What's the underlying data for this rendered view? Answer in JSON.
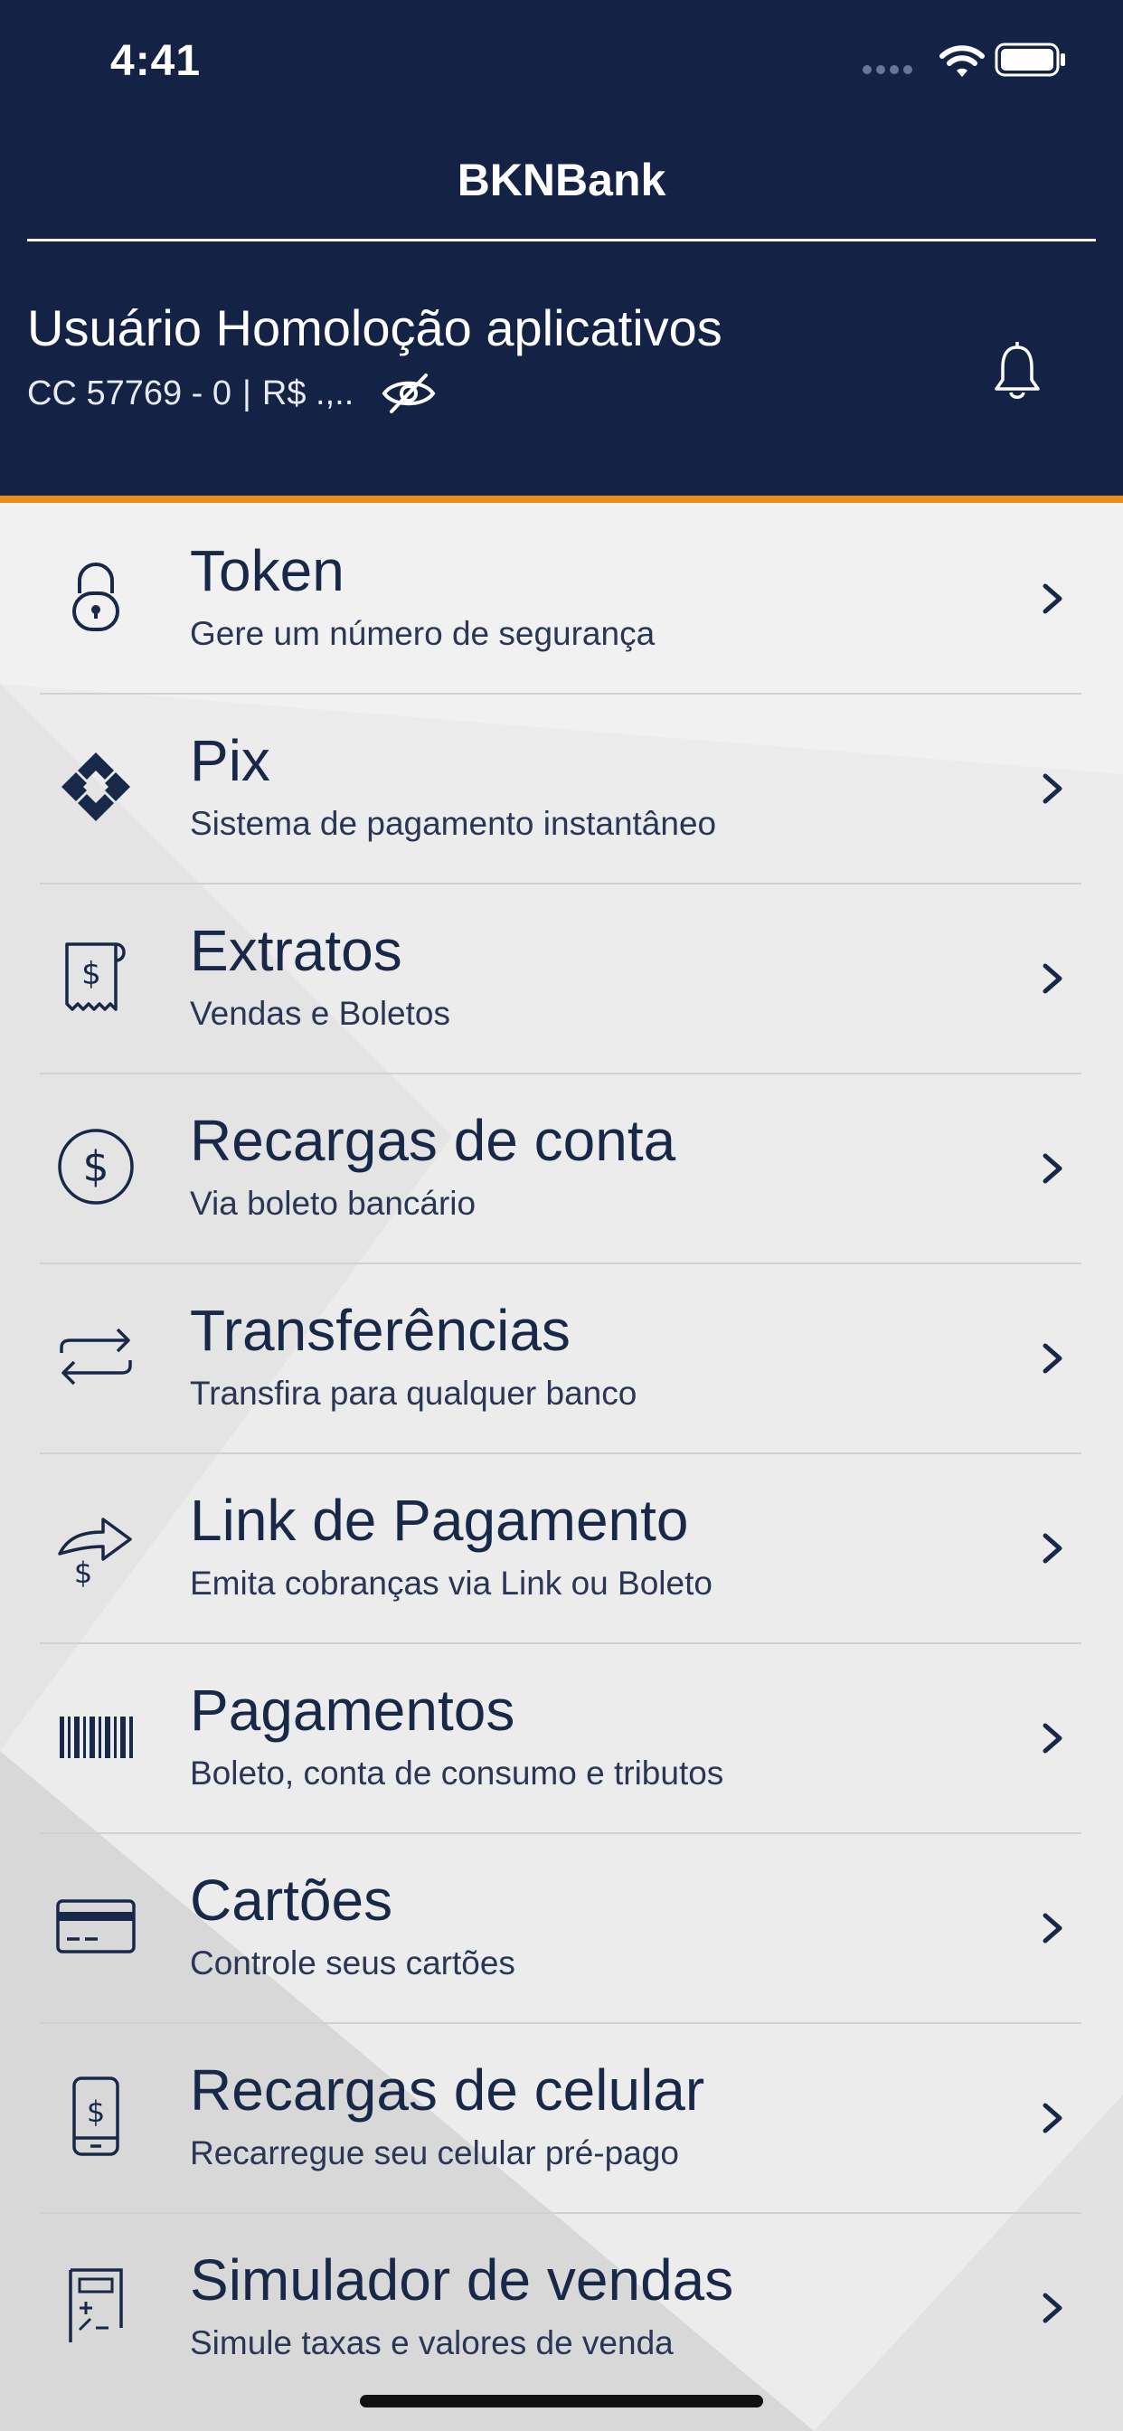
{
  "status_bar": {
    "time": "4:41"
  },
  "header": {
    "app_title": "BKNBank",
    "user_name": "Usuário Homoloção aplicativos",
    "account": "CC 57769 - 0",
    "separator": "|",
    "balance": "R$ .,..",
    "eye_icon": "eye-slash-icon",
    "bell_icon": "bell-icon"
  },
  "colors": {
    "header_bg": "#142246",
    "accent": "#e88d1a",
    "text_dark": "#172849"
  },
  "menu": {
    "items": [
      {
        "title": "Token",
        "subtitle": "Gere um número de segurança",
        "icon": "lock-icon"
      },
      {
        "title": "Pix",
        "subtitle": "Sistema de pagamento instantâneo",
        "icon": "pix-icon"
      },
      {
        "title": "Extratos",
        "subtitle": "Vendas e Boletos",
        "icon": "receipt-icon"
      },
      {
        "title": "Recargas de conta",
        "subtitle": "Via boleto bancário",
        "icon": "dollar-circle-icon"
      },
      {
        "title": "Transferências",
        "subtitle": "Transfira para qualquer banco",
        "icon": "transfer-arrows-icon"
      },
      {
        "title": "Link de Pagamento",
        "subtitle": "Emita cobranças via Link ou Boleto",
        "icon": "share-dollar-icon"
      },
      {
        "title": "Pagamentos",
        "subtitle": "Boleto, conta de consumo e tributos",
        "icon": "barcode-icon"
      },
      {
        "title": "Cartões",
        "subtitle": "Controle seus cartões",
        "icon": "credit-card-icon"
      },
      {
        "title": "Recargas de celular",
        "subtitle": "Recarregue seu celular pré-pago",
        "icon": "phone-dollar-icon"
      },
      {
        "title": "Simulador de vendas",
        "subtitle": "Simule taxas e valores de venda",
        "icon": "calculator-icon"
      }
    ]
  }
}
